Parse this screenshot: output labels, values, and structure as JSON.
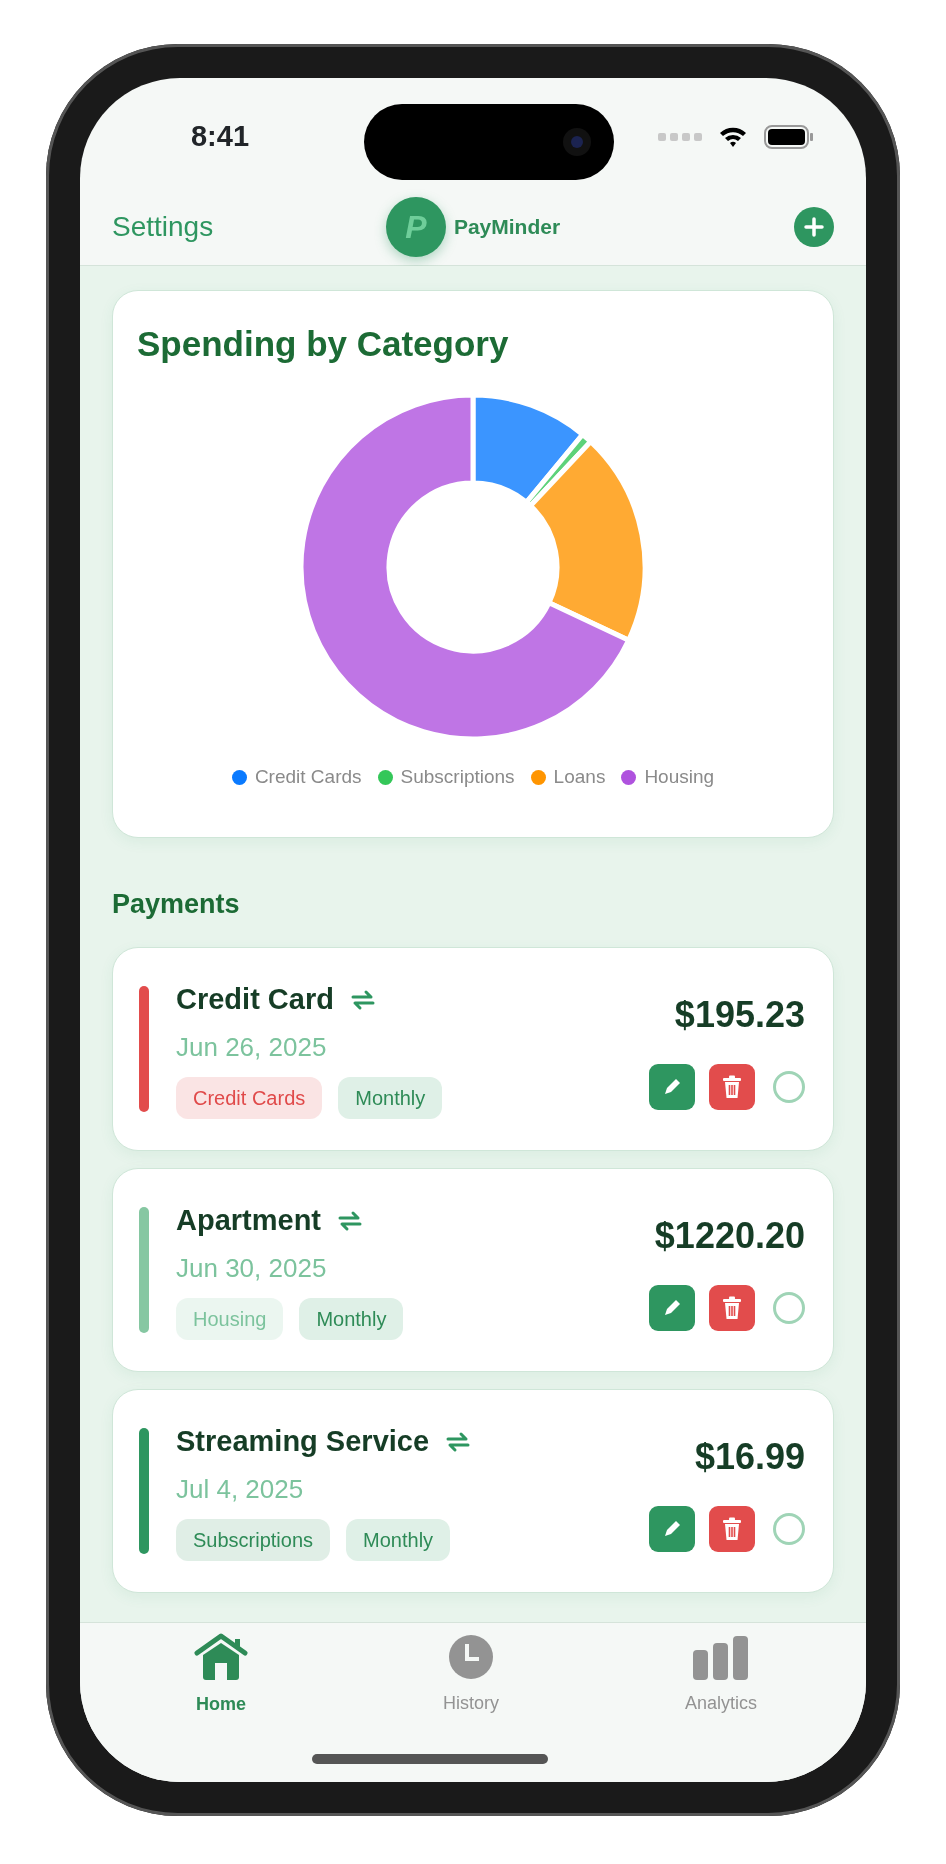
{
  "status_bar": {
    "time": "8:41"
  },
  "header": {
    "settings": "Settings",
    "logo_letter": "P",
    "app_name": "PayMinder"
  },
  "chart_card": {
    "title": "Spending by Category",
    "legend": [
      {
        "label": "Credit Cards",
        "color": "#0a7aff"
      },
      {
        "label": "Subscriptions",
        "color": "#34c759"
      },
      {
        "label": "Loans",
        "color": "#ff9500"
      },
      {
        "label": "Housing",
        "color": "#af52de"
      }
    ]
  },
  "payments_heading": "Payments",
  "payments": [
    {
      "name": "Credit Card",
      "recurring": true,
      "date": "Jun 26, 2025",
      "amount": "$195.23",
      "category": {
        "label": "Credit Cards",
        "color": "#e04a4a"
      },
      "frequency": "Monthly",
      "color": "#e24c4c",
      "paid": false
    },
    {
      "name": "Apartment",
      "recurring": true,
      "date": "Jun 30, 2025",
      "amount": "$1220.20",
      "category": {
        "label": "Housing",
        "color": "#7cc39d"
      },
      "frequency": "Monthly",
      "color": "#86c7a2",
      "paid": false
    },
    {
      "name": "Streaming Service",
      "recurring": true,
      "date": "Jul 4, 2025",
      "amount": "$16.99",
      "category": {
        "label": "Subscriptions",
        "color": "#2e8b57"
      },
      "frequency": "Monthly",
      "color": "#2e9660",
      "paid": false
    }
  ],
  "tabs": [
    {
      "label": "Home",
      "selected": true
    },
    {
      "label": "History",
      "selected": false
    },
    {
      "label": "Analytics",
      "selected": false
    }
  ]
}
